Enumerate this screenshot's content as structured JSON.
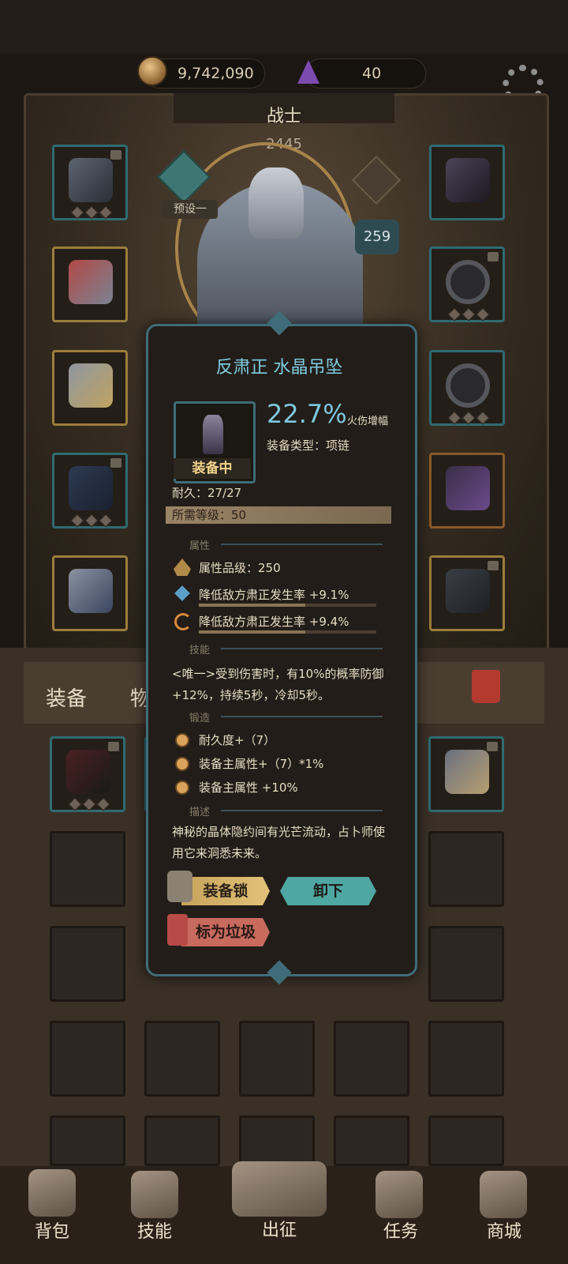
{
  "currency": {
    "gold": "9,742,090",
    "gems": "40",
    "gold_icon": "coin-icon",
    "gem_icon": "purple-gem-icon"
  },
  "character": {
    "class_name": "战士",
    "power": "2445",
    "preset_label": "预设一",
    "level_badge": "259"
  },
  "item_popup": {
    "name": "反肃正 水晶吊坠",
    "main_value": "22.7%",
    "main_stat_label": "火伤增幅",
    "equip_type": "装备类型：项链",
    "equipped_tag": "装备中",
    "durability": "耐久：27/27",
    "required_level": "所需等级：50",
    "sec_attributes": "属性",
    "attribute_grade": "属性品级：250",
    "attribute_1": "降低敌方肃正发生率 +9.1%",
    "attribute_2": "降低敌方肃正发生率 +9.4%",
    "sec_skill": "技能",
    "skill_text": "<唯一>受到伤害时，有10%的概率防御+12%，持续5秒，冷却5秒。",
    "sec_forge": "锻造",
    "forge_1": "耐久度+（7）",
    "forge_2": "装备主属性+（7）*1%",
    "forge_3": "装备主属性 +10%",
    "sec_desc": "描述",
    "description": "神秘的晶体隐约间有光芒流动，占卜师使用它来洞悉未来。",
    "lock_button": "装备锁",
    "unequip_button": "卸下",
    "trash_button": "标为垃圾"
  },
  "inventory": {
    "tab_equipment": "装备",
    "tab_items_partial": "物"
  },
  "nav": [
    {
      "label": "背包",
      "icon": "backpack-icon"
    },
    {
      "label": "技能",
      "icon": "skill-book-icon"
    },
    {
      "label": "出征",
      "icon": "sword-map-icon"
    },
    {
      "label": "任务",
      "icon": "scroll-icon"
    },
    {
      "label": "商城",
      "icon": "shop-crown-icon"
    }
  ],
  "colors": {
    "accent_teal": "#7fcde0",
    "gold_text": "#f0d28a",
    "unequip_btn": "#4fa7a3",
    "trash_btn": "#c86a5e"
  }
}
